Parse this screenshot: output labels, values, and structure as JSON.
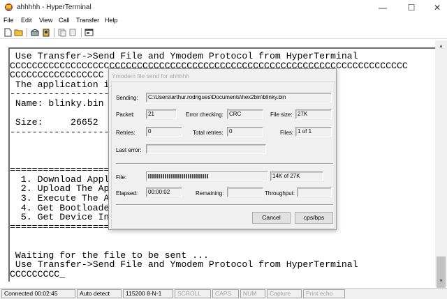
{
  "window": {
    "title": "ahhhhh - HyperTerminal",
    "minimize_glyph": "—",
    "maximize_glyph": "☐",
    "close_glyph": "✕"
  },
  "menu": [
    "File",
    "Edit",
    "View",
    "Call",
    "Transfer",
    "Help"
  ],
  "toolbar": {
    "buttons": [
      "new-document-icon",
      "open-folder-icon",
      "phone-icon",
      "disconnect-icon",
      "send-icon",
      "receive-icon",
      "properties-icon"
    ]
  },
  "terminal": {
    "lines": [
      " Use Transfer->Send File and Ymodem Protocol from HyperTerminal",
      "CCCCCCCCCCCCCCCCCCCCCCCCCCCCCCCCCCCCCCCCCCCCCCCCCCCCCCCCCCCCCCCCCCCCCCCC",
      "CCCCCCCCCCCCCCCCC",
      " The application im",
      "--------------------",
      " Name: blinky.bin",
      "",
      " Size:     26652",
      "--------------------",
      "",
      "",
      "",
      "==================",
      "  1. Download Appli",
      "  2. Upload The App",
      "  3. Execute The Ap",
      "  4. Get Bootloader",
      "  5. Get Device Inf",
      "====================",
      "",
      "",
      " Waiting for the file to be sent ...",
      " Use Transfer->Send File and Ymodem Protocol from HyperTerminal",
      "CCCCCCCCC_"
    ]
  },
  "dialog": {
    "title": "Ymodem file send for ahhhhh",
    "sending_label": "Sending:",
    "sending_value": "C:\\Users\\arthur.rodrigues\\Documents\\hex2bin\\blinky.bin",
    "packet_label": "Packet:",
    "packet_value": "21",
    "error_checking_label": "Error checking:",
    "error_checking_value": "CRC",
    "file_size_label": "File size:",
    "file_size_value": "27K",
    "retries_label": "Retries:",
    "retries_value": "0",
    "total_retries_label": "Total retries:",
    "total_retries_value": "0",
    "files_label": "Files:",
    "files_value": "1 of 1",
    "last_error_label": "Last error:",
    "last_error_value": "",
    "file_label": "File:",
    "file_progress_text": "14K of 27K",
    "file_progress_fraction": 0.52,
    "elapsed_label": "Elapsed:",
    "elapsed_value": "00:00:02",
    "remaining_label": "Remaining:",
    "remaining_value": "",
    "throughput_label": "Throughput:",
    "throughput_value": "",
    "cancel_label": "Cancel",
    "cps_label": "cps/bps"
  },
  "statusbar": {
    "connected": "Connected 00:02:45",
    "detect": "Auto detect",
    "settings": "115200 8-N-1",
    "scroll": "SCROLL",
    "caps": "CAPS",
    "num": "NUM",
    "capture": "Capture",
    "print_echo": "Print echo"
  },
  "colors": {
    "app_icon": "#c0392b",
    "dialog_bg": "#f0f0f0",
    "dim_text": "#a0a0a0"
  }
}
